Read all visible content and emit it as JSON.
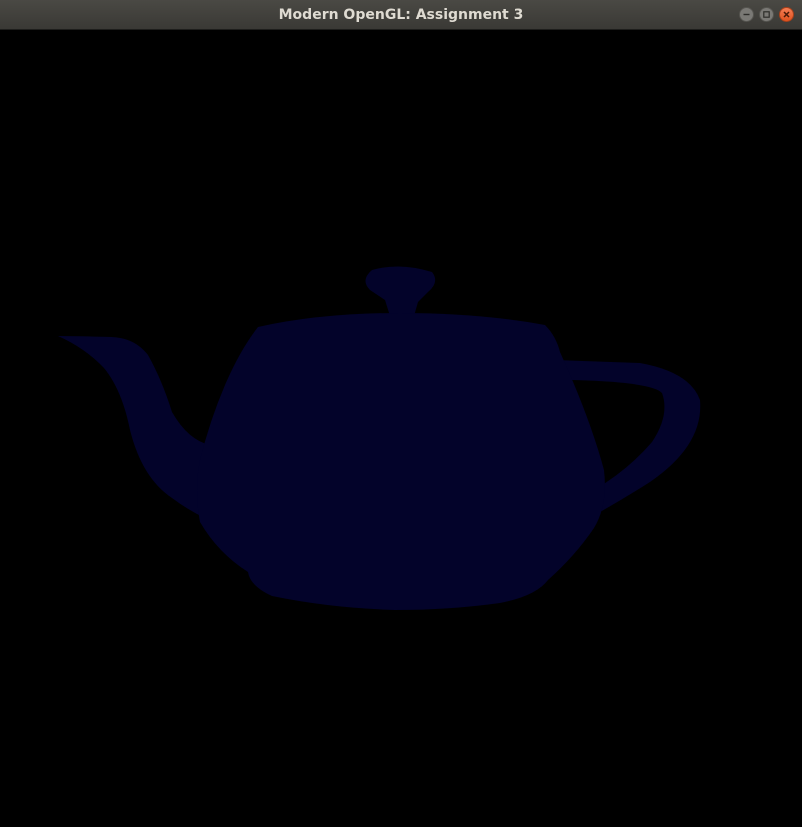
{
  "window": {
    "title": "Modern OpenGL: Assignment 3"
  },
  "controls": {
    "minimize": "minimize-icon",
    "maximize": "maximize-icon",
    "close": "close-icon"
  },
  "scene": {
    "background_color": "#000000",
    "object": "teapot",
    "object_color": "#03032a"
  },
  "colors": {
    "titlebar": "#3d3c38",
    "title_text": "#dfdbd2",
    "close_button": "#e8602c"
  }
}
